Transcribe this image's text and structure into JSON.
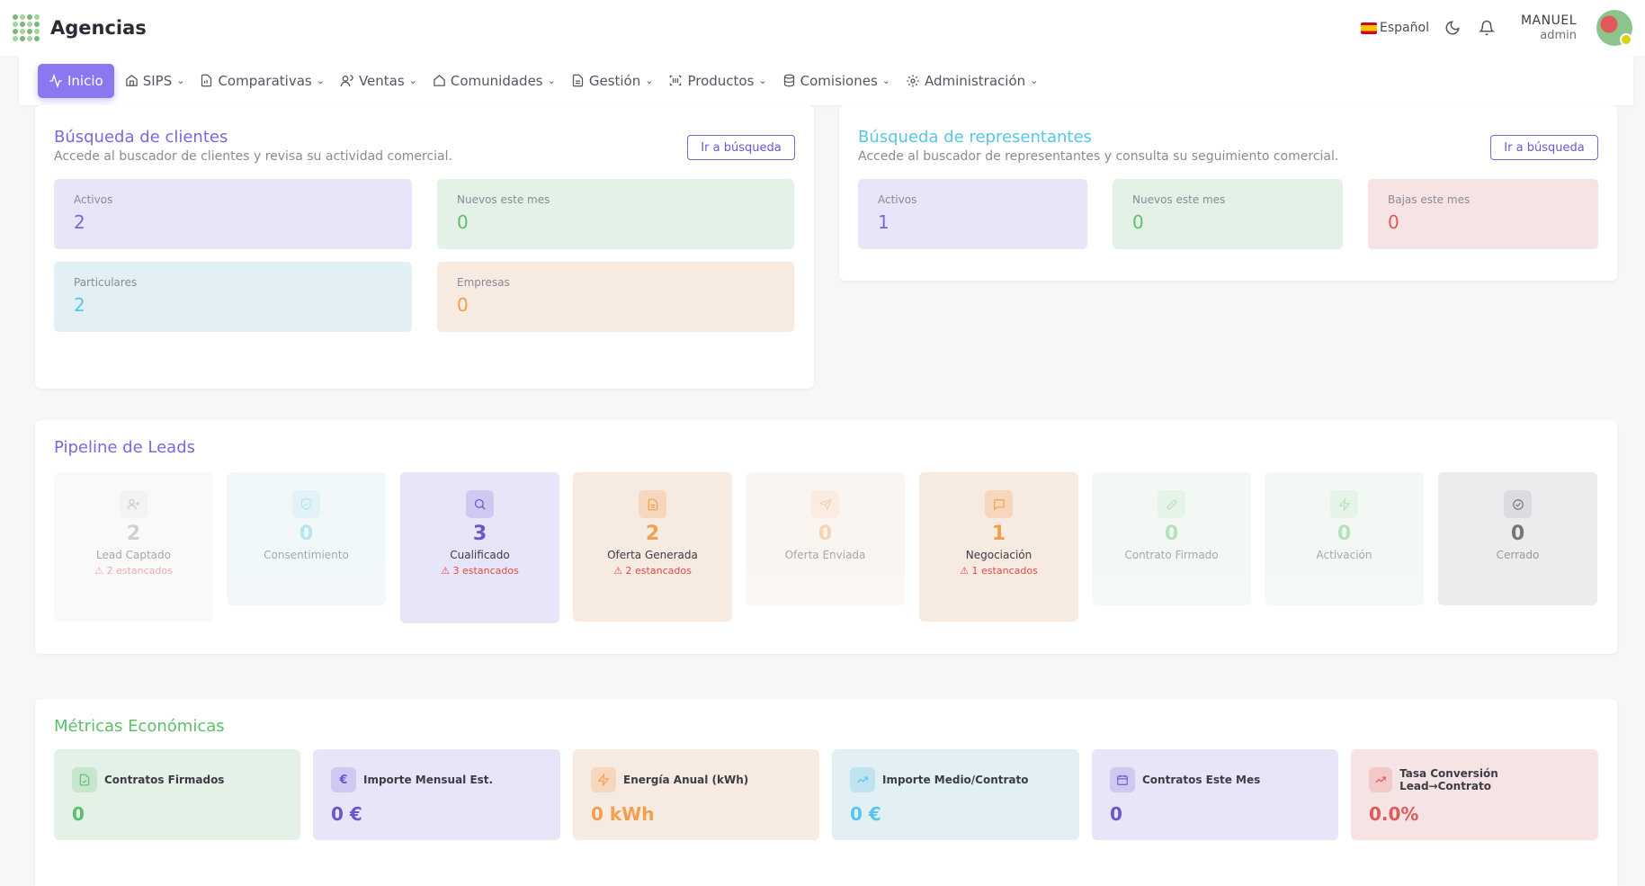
{
  "app": {
    "title": "Agencias"
  },
  "header": {
    "language": "Español",
    "user_name": "MANUEL",
    "user_role": "admin"
  },
  "nav": {
    "items": [
      {
        "label": "Inicio",
        "icon": "activity-icon"
      },
      {
        "label": "SIPS",
        "icon": "house-icon"
      },
      {
        "label": "Comparativas",
        "icon": "file-chart-icon"
      },
      {
        "label": "Ventas",
        "icon": "users-icon"
      },
      {
        "label": "Comunidades",
        "icon": "home-icon"
      },
      {
        "label": "Gestión",
        "icon": "document-icon"
      },
      {
        "label": "Productos",
        "icon": "barcode-icon"
      },
      {
        "label": "Comisiones",
        "icon": "database-icon"
      },
      {
        "label": "Administración",
        "icon": "gear-icon"
      }
    ]
  },
  "clients": {
    "title": "Búsqueda de clientes",
    "subtitle": "Accede al buscador de clientes y revisa su actividad comercial.",
    "button": "Ir a búsqueda",
    "stats": [
      {
        "label": "Activos",
        "value": "2"
      },
      {
        "label": "Nuevos este mes",
        "value": "0"
      },
      {
        "label": "Particulares",
        "value": "2"
      },
      {
        "label": "Empresas",
        "value": "0"
      }
    ]
  },
  "reps": {
    "title": "Búsqueda de representantes",
    "subtitle": "Accede al buscador de representantes y consulta su seguimiento comercial.",
    "button": "Ir a búsqueda",
    "stats": [
      {
        "label": "Activos",
        "value": "1"
      },
      {
        "label": "Nuevos este mes",
        "value": "0"
      },
      {
        "label": "Bajas este mes",
        "value": "0"
      }
    ]
  },
  "pipeline": {
    "title": "Pipeline de Leads",
    "stages": [
      {
        "name": "Lead Captado",
        "count": "2",
        "stuck": "2 estancados",
        "icon": "user-plus-icon"
      },
      {
        "name": "Consentimiento",
        "count": "0",
        "stuck": "",
        "icon": "shield-check-icon"
      },
      {
        "name": "Cualificado",
        "count": "3",
        "stuck": "3 estancados",
        "icon": "search-icon"
      },
      {
        "name": "Oferta Generada",
        "count": "2",
        "stuck": "2 estancados",
        "icon": "document-icon"
      },
      {
        "name": "Oferta Enviada",
        "count": "0",
        "stuck": "",
        "icon": "send-icon"
      },
      {
        "name": "Negociación",
        "count": "1",
        "stuck": "1 estancados",
        "icon": "chat-icon"
      },
      {
        "name": "Contrato Firmado",
        "count": "0",
        "stuck": "",
        "icon": "signature-icon"
      },
      {
        "name": "Activación",
        "count": "0",
        "stuck": "",
        "icon": "bolt-icon"
      },
      {
        "name": "Cerrado",
        "count": "0",
        "stuck": "",
        "icon": "check-circle-icon"
      }
    ]
  },
  "metrics": {
    "title": "Métricas Económicas",
    "items": [
      {
        "label": "Contratos Firmados",
        "value": "0",
        "icon": "file-check-icon"
      },
      {
        "label": "Importe Mensual Est.",
        "value": "0 €",
        "icon": "euro-icon"
      },
      {
        "label": "Energía Anual (kWh)",
        "value": "0 kWh",
        "icon": "bolt-icon"
      },
      {
        "label": "Importe Medio/Contrato",
        "value": "0 €",
        "icon": "trending-up-icon"
      },
      {
        "label": "Contratos Este Mes",
        "value": "0",
        "icon": "calendar-icon"
      },
      {
        "label": "Tasa Conversión Lead→Contrato",
        "value": "0.0%",
        "icon": "trending-up-icon"
      }
    ]
  },
  "colors": {
    "accent": "#8b78f0",
    "green": "#5cc06a",
    "blue": "#58c6e6",
    "orange": "#f0a050",
    "red": "#e05a5a"
  }
}
